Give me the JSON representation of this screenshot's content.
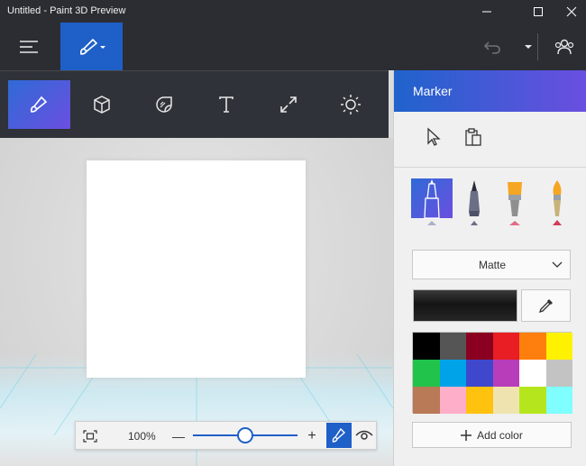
{
  "window": {
    "title": "Untitled - Paint 3D Preview"
  },
  "toolbar": {
    "menu_icon": "hamburger-menu-icon",
    "brush_icon": "paintbrush-icon",
    "undo_icon": "undo-icon",
    "people_icon": "people-icon"
  },
  "tools": [
    {
      "name": "art-tools",
      "icon": "brush-icon",
      "active": true
    },
    {
      "name": "3d-objects",
      "icon": "cube-icon",
      "active": false
    },
    {
      "name": "stickers",
      "icon": "sticker-icon",
      "active": false
    },
    {
      "name": "text",
      "icon": "text-icon",
      "active": false
    },
    {
      "name": "canvas",
      "icon": "resize-icon",
      "active": false
    },
    {
      "name": "effects",
      "icon": "sun-icon",
      "active": false
    }
  ],
  "canvas": {
    "zoom": "100%",
    "zoom_fraction": 0.5,
    "minus_label": "—",
    "plus_label": "+"
  },
  "panel": {
    "title": "Marker",
    "finish": "Matte",
    "current_color": "#1b1b1b",
    "add_color_label": "Add color",
    "accent": "#1f5fc8"
  },
  "palette": [
    "#000000",
    "#555555",
    "#8b0020",
    "#e81e24",
    "#ff7f0e",
    "#fff200",
    "#22c34a",
    "#00a2e8",
    "#3f48cc",
    "#b83dba",
    "#ffffff",
    "#c3c3c3",
    "#b97a57",
    "#ffaec9",
    "#ffc20e",
    "#efe4b0",
    "#b5e61d",
    "#7fffff"
  ]
}
